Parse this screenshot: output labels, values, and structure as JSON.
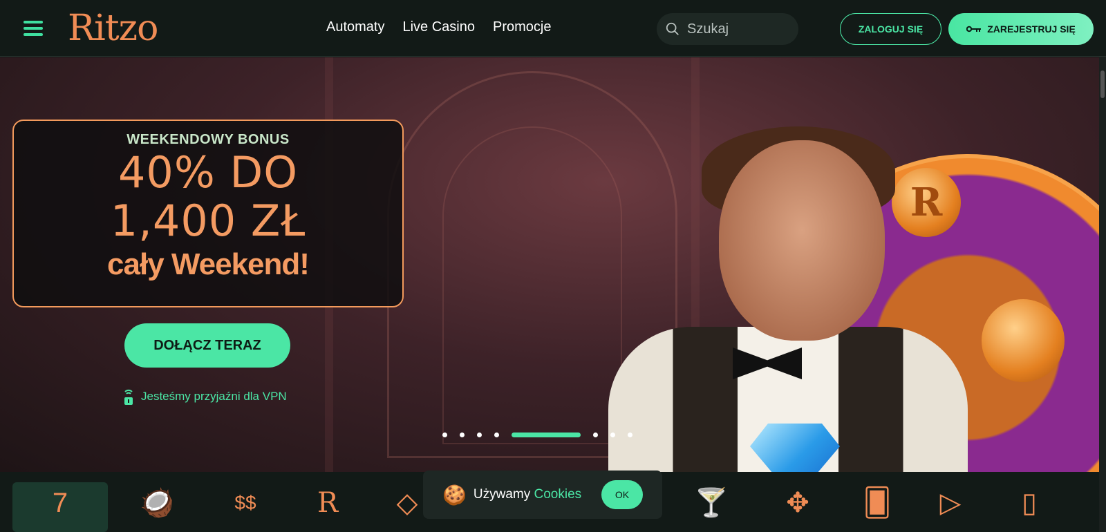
{
  "header": {
    "logo": "Ritzo",
    "nav": [
      "Automaty",
      "Live Casino",
      "Promocje"
    ],
    "search_placeholder": "Szukaj",
    "login_label": "ZALOGUJ SIĘ",
    "register_label": "ZAREJESTRUJ SIĘ",
    "accent_color": "#4be6a5",
    "brand_color": "#f08c55"
  },
  "hero": {
    "label": "WEEKENDOWY BONUS",
    "line1": "40% DO",
    "line2": "1,400 ZŁ",
    "line3": "cały Weekend!",
    "cta": "DOŁĄCZ TERAZ",
    "vpn_text": "Jesteśmy przyjaźni dla VPN",
    "slide_count": 8,
    "active_slide": 5
  },
  "categories": [
    {
      "icon": "slot-machine-icon",
      "glyph": "7"
    },
    {
      "icon": "coconut-drink-icon",
      "glyph": "🥥"
    },
    {
      "icon": "money-bag-icon",
      "glyph": "$$"
    },
    {
      "icon": "laurel-r-icon",
      "glyph": "R"
    },
    {
      "icon": "diamond-icon",
      "glyph": "◇"
    },
    {
      "icon": "new-games-icon",
      "glyph": "▤"
    },
    {
      "icon": "coins-icon",
      "glyph": "◎"
    },
    {
      "icon": "club-icon",
      "glyph": "♣"
    },
    {
      "icon": "cocktail-icon",
      "glyph": "🍸"
    },
    {
      "icon": "poker-chip-icon",
      "glyph": "✥"
    },
    {
      "icon": "cards-icon",
      "glyph": "🂠"
    },
    {
      "icon": "fast-play-icon",
      "glyph": "▷"
    },
    {
      "icon": "phone-card-icon",
      "glyph": "▯"
    }
  ],
  "cookie": {
    "text": "Używamy",
    "highlight": "Cookies",
    "ok": "OK"
  }
}
